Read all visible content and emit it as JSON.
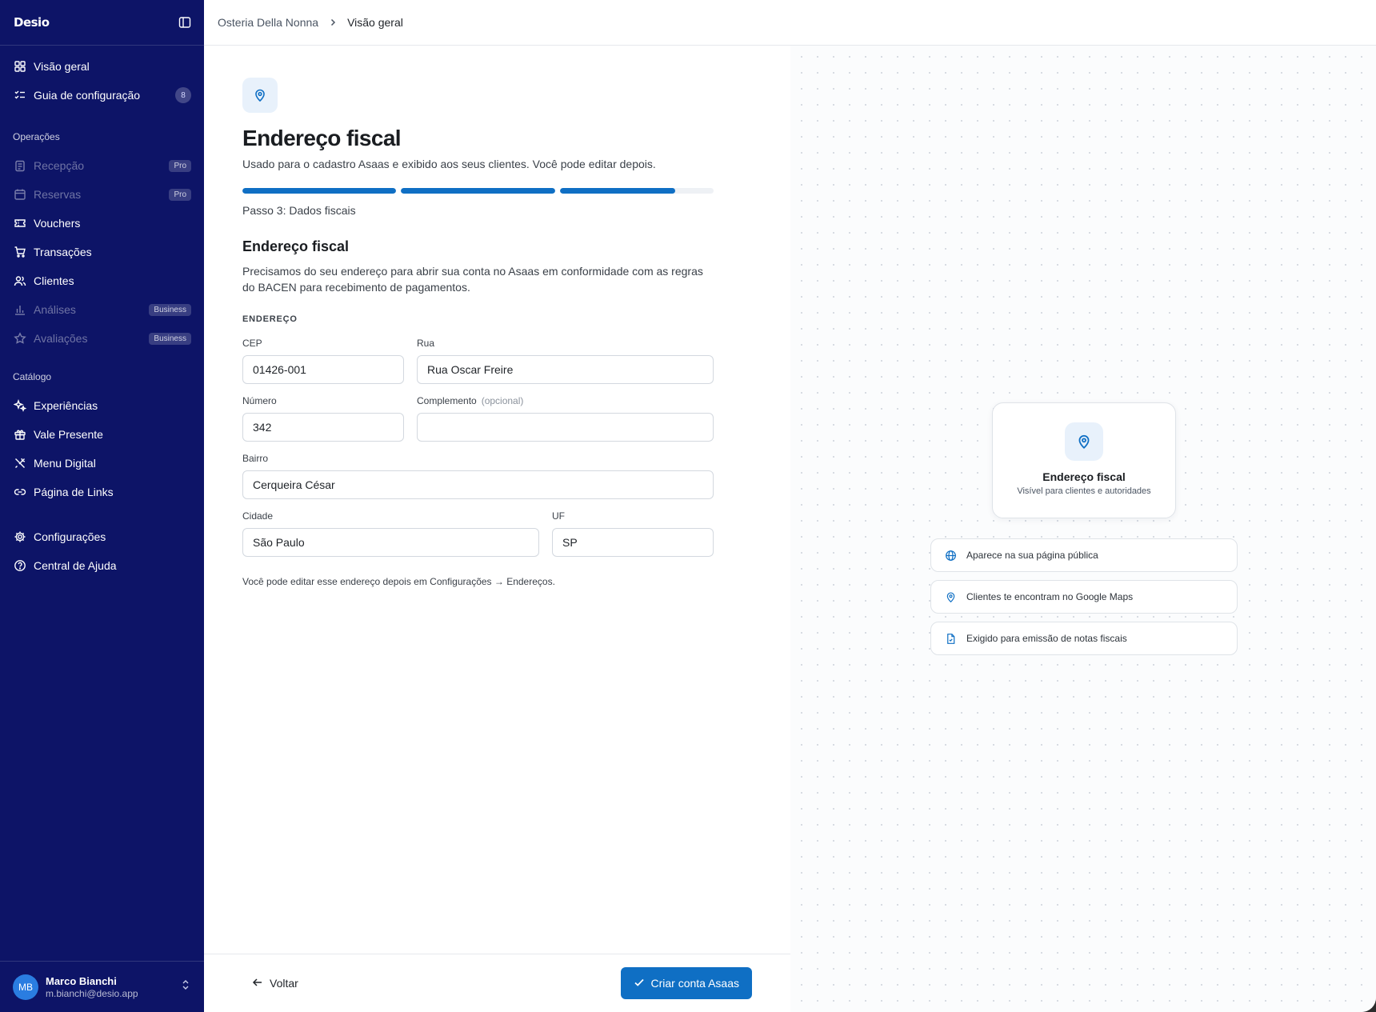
{
  "app": {
    "logo": "Desio"
  },
  "sidebar": {
    "top_items": [
      {
        "label": "Visão geral",
        "icon": "grid-icon"
      },
      {
        "label": "Guia de configuração",
        "icon": "checklist-icon",
        "badge": "8"
      }
    ],
    "operations_label": "Operações",
    "operations": [
      {
        "label": "Recepção",
        "icon": "clipboard-icon",
        "tag": "Pro",
        "disabled": true
      },
      {
        "label": "Reservas",
        "icon": "calendar-icon",
        "tag": "Pro",
        "disabled": true
      },
      {
        "label": "Vouchers",
        "icon": "ticket-icon"
      },
      {
        "label": "Transações",
        "icon": "cart-icon"
      },
      {
        "label": "Clientes",
        "icon": "users-icon"
      },
      {
        "label": "Análises",
        "icon": "bar-chart-icon",
        "tag": "Business",
        "disabled": true
      },
      {
        "label": "Avaliações",
        "icon": "star-icon",
        "tag": "Business",
        "disabled": true
      }
    ],
    "catalog_label": "Catálogo",
    "catalog": [
      {
        "label": "Experiências",
        "icon": "sparkles-icon"
      },
      {
        "label": "Vale Presente",
        "icon": "gift-icon"
      },
      {
        "label": "Menu Digital",
        "icon": "utensils-icon"
      },
      {
        "label": "Página de Links",
        "icon": "link-icon"
      }
    ],
    "bottom": [
      {
        "label": "Configurações",
        "icon": "gear-icon"
      },
      {
        "label": "Central de Ajuda",
        "icon": "help-circle-icon"
      }
    ],
    "user": {
      "initials": "MB",
      "name": "Marco Bianchi",
      "email": "m.bianchi@desio.app"
    }
  },
  "breadcrumb": {
    "parent": "Osteria Della Nonna",
    "current": "Visão geral"
  },
  "form": {
    "title": "Endereço fiscal",
    "subtitle": "Usado para o cadastro Asaas e exibido aos seus clientes. Você pode editar depois.",
    "progress": [
      1,
      1,
      0.75
    ],
    "step_label": "Passo 3: Dados fiscais",
    "section_title": "Endereço fiscal",
    "section_desc": "Precisamos do seu endereço para abrir sua conta no Asaas em conformidade com as regras do BACEN para recebimento de pagamentos.",
    "group_label": "ENDEREÇO",
    "fields": {
      "cep": {
        "label": "CEP",
        "value": "01426-001"
      },
      "rua": {
        "label": "Rua",
        "value": "Rua Oscar Freire"
      },
      "numero": {
        "label": "Número",
        "value": "342"
      },
      "complemento": {
        "label": "Complemento",
        "optional": "(opcional)",
        "value": ""
      },
      "bairro": {
        "label": "Bairro",
        "value": "Cerqueira César"
      },
      "cidade": {
        "label": "Cidade",
        "value": "São Paulo"
      },
      "uf": {
        "label": "UF",
        "value": "SP"
      }
    },
    "note": "Você pode editar esse endereço depois em Configurações → Endereços.",
    "back_label": "Voltar",
    "submit_label": "Criar conta Asaas"
  },
  "preview": {
    "card_title": "Endereço fiscal",
    "card_sub": "Visível para clientes e autoridades",
    "benefits": [
      {
        "icon": "globe-icon",
        "text": "Aparece na sua página pública"
      },
      {
        "icon": "map-pin-icon",
        "text": "Clientes te encontram no Google Maps"
      },
      {
        "icon": "document-icon",
        "text": "Exigido para emissão de notas fiscais"
      }
    ]
  },
  "colors": {
    "sidebar": "#0d1467",
    "accent": "#0f6fc4",
    "accent_soft": "#e8f1fb"
  }
}
